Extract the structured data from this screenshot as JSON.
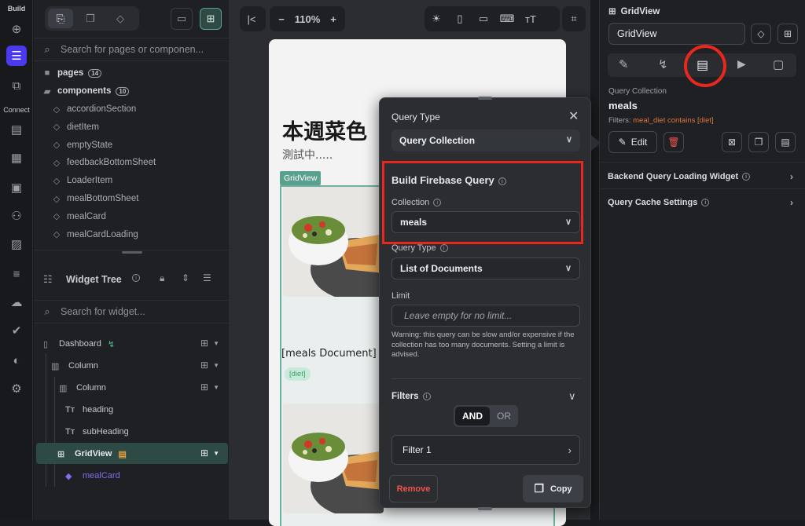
{
  "rail": {
    "build_label": "Build",
    "connect_label": "Connect",
    "icons": [
      "add-page-icon",
      "widget-tree-icon",
      "components-icon",
      "database-icon",
      "api-icon",
      "storage-icon",
      "integrations-icon",
      "media-icon",
      "list-icon",
      "cloud-icon",
      "ai-agent-icon",
      "theme-icon",
      "settings-icon"
    ]
  },
  "navigator": {
    "search_placeholder": "Search for pages or componen...",
    "pages_label": "pages",
    "pages_count": "14",
    "components_label": "components",
    "components_count": "10",
    "components": [
      "accordionSection",
      "dietItem",
      "emptyState",
      "feedbackBottomSheet",
      "LoaderItem",
      "mealBottomSheet",
      "mealCard",
      "mealCardLoading"
    ]
  },
  "widget_tree": {
    "title": "Widget Tree",
    "search_placeholder": "Search for widget...",
    "nodes": [
      "Dashboard",
      "Column",
      "Column",
      "heading",
      "subHeading",
      "GridView",
      "mealCard"
    ]
  },
  "toolbar": {
    "zoom": "110%",
    "minus": "−",
    "plus": "+"
  },
  "phone": {
    "title": "本週菜色",
    "subtitle": "測試中.....",
    "grid_tag": "GridView",
    "card_label": "[meals Document]",
    "card_tag": "[diet]"
  },
  "popup": {
    "query_type_title": "Query Type",
    "query_type_value": "Query Collection",
    "build_title": "Build Firebase Query",
    "collection_label": "Collection",
    "collection_value": "meals",
    "query_type2_label": "Query Type",
    "query_type2_value": "List of Documents",
    "limit_label": "Limit",
    "limit_placeholder": "Leave empty for no limit...",
    "warning": "Warning: this query can be slow and/or expensive if the collection has too many documents. Setting a limit is advised.",
    "filters_label": "Filters",
    "and_label": "AND",
    "or_label": "OR",
    "filter_item": "Filter 1",
    "remove_label": "Remove",
    "copy_label": "Copy"
  },
  "props": {
    "widget_type": "GridView",
    "widget_name": "GridView",
    "query_collection_label": "Query Collection",
    "query_collection_value": "meals",
    "filters_prefix": "Filters:",
    "filters_value": "meal_diet contains [diet]",
    "edit_label": "Edit",
    "backend_loading": "Backend Query Loading Widget",
    "cache_settings": "Query Cache Settings"
  },
  "colors": {
    "accent": "#4b39ef",
    "highlight_red": "#e8281e",
    "teal": "#5aa08f",
    "filters_orange": "#e0733c",
    "remove_red": "#ef5350"
  }
}
